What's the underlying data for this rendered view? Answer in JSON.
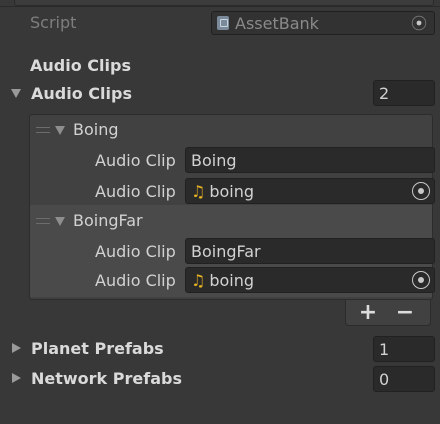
{
  "script": {
    "label": "Script",
    "value": "AssetBank"
  },
  "header": {
    "section_title": "Audio Clips"
  },
  "audio_clips": {
    "label": "Audio Clips",
    "size": "2",
    "elements": [
      {
        "name": "Boing",
        "name_field_label": "Audio Clip",
        "name_field_value": "Boing",
        "clip_field_label": "Audio Clip",
        "clip_field_value": "boing"
      },
      {
        "name": "BoingFar",
        "name_field_label": "Audio Clip",
        "name_field_value": "BoingFar",
        "clip_field_label": "Audio Clip",
        "clip_field_value": "boing"
      }
    ],
    "add_label": "+",
    "remove_label": "−"
  },
  "planet_prefabs": {
    "label": "Planet Prefabs",
    "size": "1"
  },
  "network_prefabs": {
    "label": "Network Prefabs",
    "size": "0"
  },
  "icons": {
    "audio_clip_icon": "music-note-icon",
    "script_icon": "script-file-icon",
    "object_picker_icon": "target-icon"
  },
  "colors": {
    "background": "#383838",
    "field": "#2a2a2a",
    "list_panel": "#414141",
    "selected_row": "#4a4a4a",
    "audio_icon": "#e6b422"
  }
}
